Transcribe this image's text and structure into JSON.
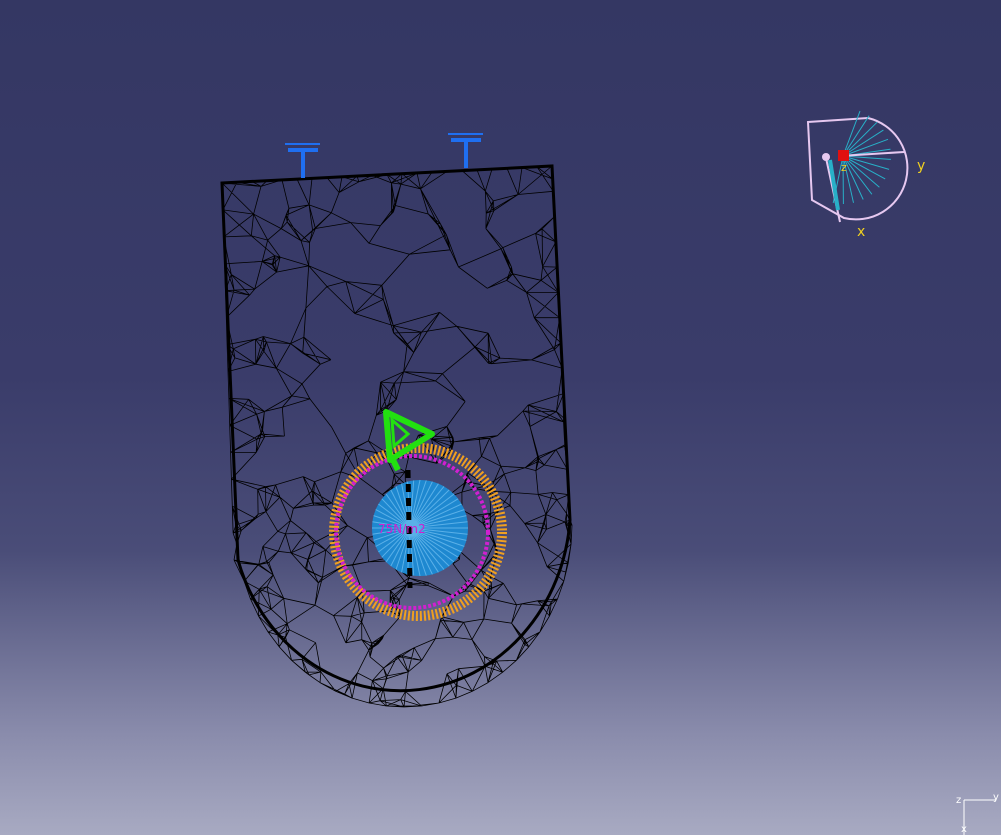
{
  "viewport": {
    "background_top": "#343763",
    "background_bottom": "#a8aac2"
  },
  "mesh": {
    "line_color": "#000000",
    "outline_color": "#000000"
  },
  "restraints": {
    "color": "#1f6ff0",
    "icon": "clamp-restraint-icon",
    "count": 2
  },
  "load": {
    "color": "#22e010",
    "icon": "force-arrow-icon"
  },
  "hole": {
    "fill_color": "#1e88d0",
    "ring_color": "#f0a020",
    "label_color": "#d020d0",
    "label": "75N/m2"
  },
  "compass": {
    "outline_color": "#e6c8f0",
    "rays_color": "#28b0c8",
    "origin_color": "#e01010",
    "axis_x": "x",
    "axis_y": "y",
    "axis_z": "z",
    "label_color": "#f0d020"
  },
  "mini_axis": {
    "label_z": "z",
    "label_y": "y",
    "label_x": "x",
    "color": "#ffffff"
  }
}
